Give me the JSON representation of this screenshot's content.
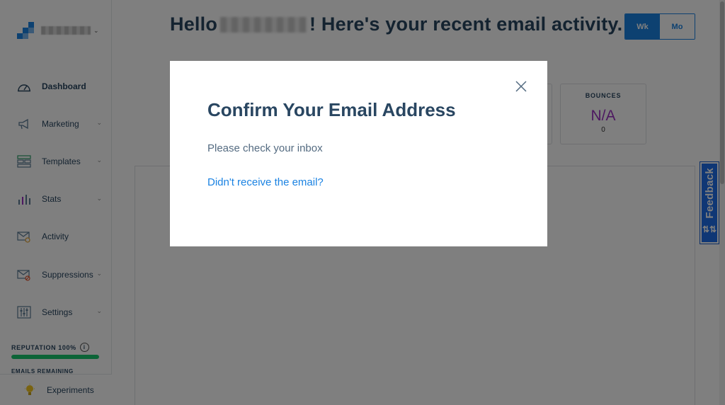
{
  "sidebar": {
    "account_chevron": "⌄",
    "items": [
      {
        "label": "Dashboard",
        "icon": "gauge-icon",
        "active": true
      },
      {
        "label": "Marketing",
        "icon": "megaphone-icon",
        "chevron": "⌄"
      },
      {
        "label": "Templates",
        "icon": "templates-icon",
        "chevron": "⌄"
      },
      {
        "label": "Stats",
        "icon": "stats-icon",
        "chevron": "⌄"
      },
      {
        "label": "Activity",
        "icon": "activity-icon"
      },
      {
        "label": "Suppressions",
        "icon": "suppressions-icon",
        "chevron": "⌄"
      },
      {
        "label": "Settings",
        "icon": "settings-icon",
        "chevron": "⌄"
      }
    ],
    "reputation_label": "REPUTATION 100%",
    "reputation_value": 1.0,
    "info_glyph": "i",
    "emails_remaining_label": "EMAILS REMAINING",
    "experiments_label": "Experiments"
  },
  "header": {
    "greeting_prefix": "Hello",
    "greeting_suffix": "! Here's your recent email activity.",
    "toggle": {
      "week": "Wk",
      "month": "Mo",
      "selected": "week"
    }
  },
  "stats": {
    "bounces": {
      "title": "BOUNCES",
      "value": "N/A",
      "count": "0"
    }
  },
  "modal": {
    "title": "Confirm Your Email Address",
    "message": "Please check your inbox",
    "link": "Didn't receive the email?"
  },
  "feedback": {
    "label": "Feedback",
    "icon_glyph": "⇅⇅"
  },
  "colors": {
    "accent": "#1a82e2",
    "text_dark": "#294661",
    "stat_value": "#9b30c2",
    "reputation_green": "#18c96e",
    "feedback_blue": "#1f6feb"
  }
}
